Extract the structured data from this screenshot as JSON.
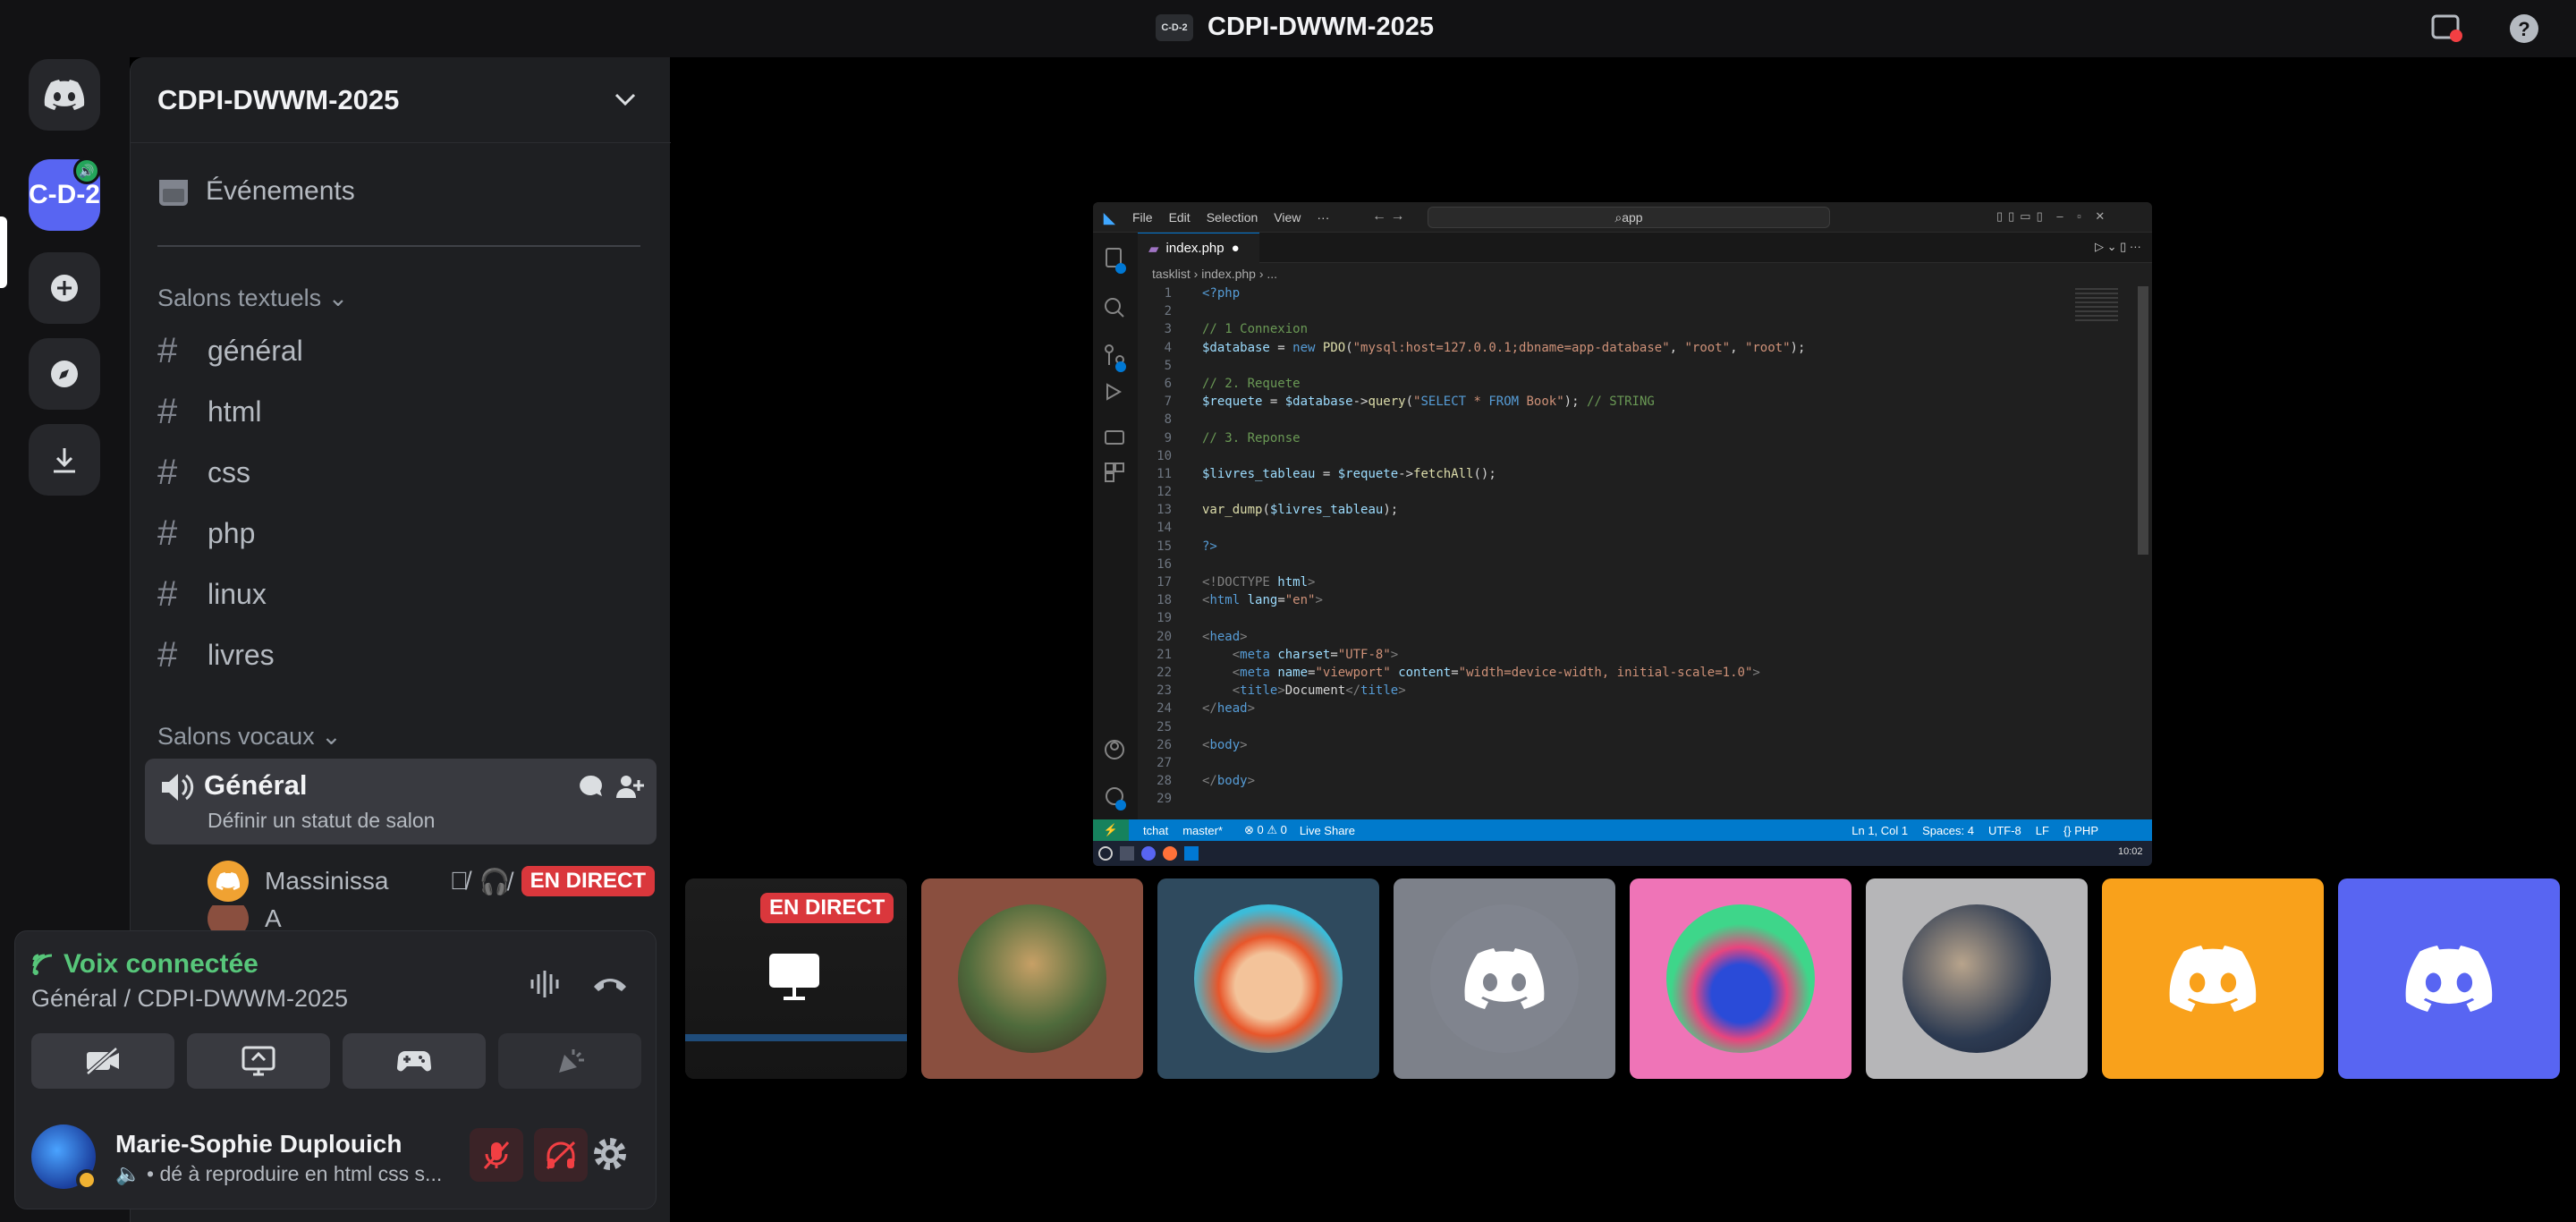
{
  "titlebar": {
    "server_badge": "C-D-2",
    "title": "CDPI-DWWM-2025"
  },
  "rail": {
    "active_server_label": "C-D-2"
  },
  "sidebar": {
    "server_name": "CDPI-DWWM-2025",
    "events_label": "Événements",
    "text_category": "Salons textuels",
    "text_channels": [
      {
        "name": "général"
      },
      {
        "name": "html"
      },
      {
        "name": "css"
      },
      {
        "name": "php"
      },
      {
        "name": "linux"
      },
      {
        "name": "livres"
      }
    ],
    "voice_category": "Salons vocaux",
    "voice_channel": {
      "name": "Général",
      "status_placeholder": "Définir un statut de salon"
    },
    "voice_users": [
      {
        "name": "Massinissa",
        "badge": "EN DIRECT"
      },
      {
        "name": "A"
      }
    ]
  },
  "voice_panel": {
    "status": "Voix connectée",
    "location": "Général / CDPI-DWWM-2025",
    "user_name": "Marie-Sophie Duplouich",
    "user_status": "• dé à reproduire en html css s..."
  },
  "stage": {
    "live_badge": "EN DIRECT",
    "tiles": [
      {
        "kind": "self-stream"
      },
      {
        "kind": "avatar",
        "color": "#8a4f3f"
      },
      {
        "kind": "avatar",
        "color": "#2f4a5e"
      },
      {
        "kind": "discord",
        "color": "#7d818a"
      },
      {
        "kind": "avatar",
        "color": "#ef74b7"
      },
      {
        "kind": "avatar",
        "color": "#b6b6b8"
      },
      {
        "kind": "discord",
        "color": "#f9a11b"
      },
      {
        "kind": "discord",
        "color": "#5865f2"
      }
    ]
  },
  "vscode": {
    "menu": [
      "File",
      "Edit",
      "Selection",
      "View",
      "···"
    ],
    "search": "app",
    "tab": "index.php",
    "breadcrumb": "tasklist  ›  index.php  ›  ...",
    "status_left": [
      "tchat",
      "master*",
      "⊗ 0 ⚠ 0",
      "Live Share"
    ],
    "status_right": [
      "Ln 1, Col 1",
      "Spaces: 4",
      "UTF-8",
      "LF",
      "{} PHP"
    ],
    "clock": "10:02"
  }
}
